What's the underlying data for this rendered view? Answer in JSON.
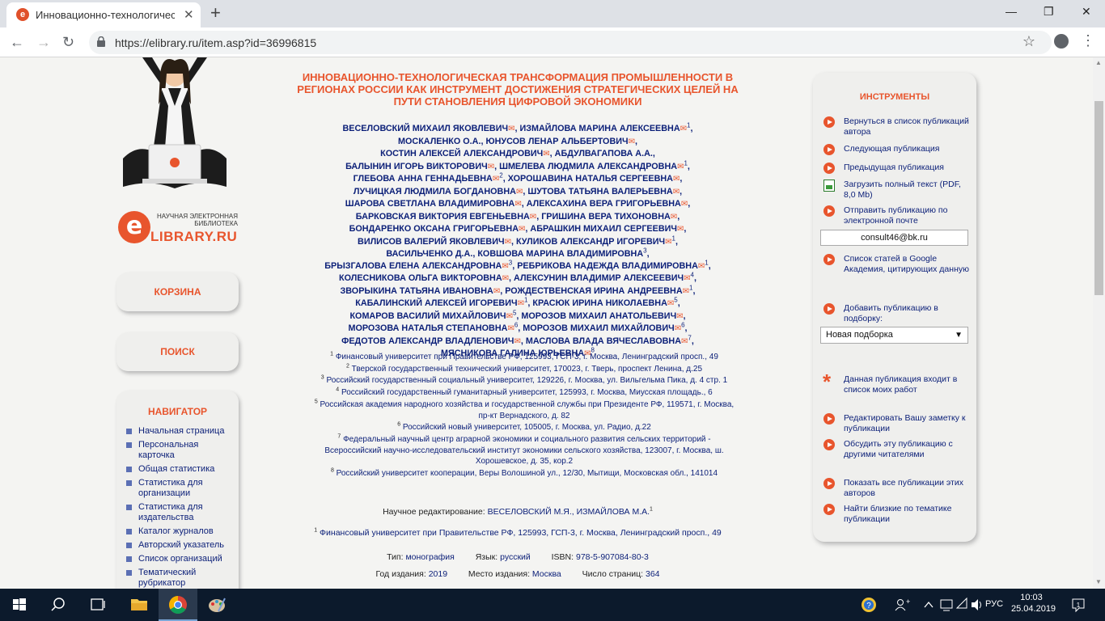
{
  "browser": {
    "tab_title": "Инновационно-технологическа",
    "tab_close": "✕",
    "new_tab": "+",
    "url": "https://elibrary.ru/item.asp?id=36996815",
    "minimize": "—",
    "maximize": "❐",
    "close": "✕"
  },
  "logo": {
    "line1": "НАУЧНАЯ ЭЛЕКТРОННАЯ",
    "line2": "БИБЛИОТЕКА",
    "letter": "e",
    "name": "LIBRARY.RU"
  },
  "sidebar": {
    "cart": "КОРЗИНА",
    "search": "ПОИСК",
    "navigator_title": "НАВИГАТОР",
    "nav_items": [
      "Начальная страница",
      "Персональная карточка",
      "Общая статистика",
      "Статистика для организации",
      "Статистика для издательства",
      "Каталог журналов",
      "Авторский указатель",
      "Список организаций",
      "Тематический рубрикатор"
    ]
  },
  "publication": {
    "title": "ИННОВАЦИОННО-ТЕХНОЛОГИЧЕСКАЯ ТРАНСФОРМАЦИЯ ПРОМЫШЛЕННОСТИ В РЕГИОНАХ РОССИИ КАК ИНСТРУМЕНТ ДОСТИЖЕНИЯ СТРАТЕГИЧЕСКИХ ЦЕЛЕЙ НА ПУТИ СТАНОВЛЕНИЯ ЦИФРОВОЙ ЭКОНОМИКИ",
    "authors": [
      {
        "name": "ВЕСЕЛОВСКИЙ МИХАИЛ ЯКОВЛЕВИЧ",
        "email": true,
        "aff": ""
      },
      {
        "name": "ИЗМАЙЛОВА МАРИНА АЛЕКСЕЕВНА",
        "email": true,
        "aff": "1"
      },
      {
        "name": "МОСКАЛЕНКО О.А.",
        "email": false,
        "aff": ""
      },
      {
        "name": "ЮНУСОВ ЛЕНАР АЛЬБЕРТОВИЧ",
        "email": true,
        "aff": ""
      },
      {
        "name": "КОСТИН АЛЕКСЕЙ АЛЕКСАНДРОВИЧ",
        "email": true,
        "aff": ""
      },
      {
        "name": "АБДУЛВАГАПОВА А.А.",
        "email": false,
        "aff": ""
      },
      {
        "name": "БАЛЫНИН ИГОРЬ ВИКТОРОВИЧ",
        "email": true,
        "aff": ""
      },
      {
        "name": "ШМЕЛЕВА ЛЮДМИЛА АЛЕКСАНДРОВНА",
        "email": true,
        "aff": "1"
      },
      {
        "name": "ГЛЕБОВА АННА ГЕННАДЬЕВНА",
        "email": true,
        "aff": "2"
      },
      {
        "name": "ХОРОШАВИНА НАТАЛЬЯ СЕРГЕЕВНА",
        "email": true,
        "aff": ""
      },
      {
        "name": "ЛУЧИЦКАЯ ЛЮДМИЛА БОГДАНОВНА",
        "email": true,
        "aff": ""
      },
      {
        "name": "ШУТОВА ТАТЬЯНА ВАЛЕРЬЕВНА",
        "email": true,
        "aff": ""
      },
      {
        "name": "ШАРОВА СВЕТЛАНА ВЛАДИМИРОВНА",
        "email": true,
        "aff": ""
      },
      {
        "name": "АЛЕКСАХИНА ВЕРА ГРИГОРЬЕВНА",
        "email": true,
        "aff": ""
      },
      {
        "name": "БАРКОВСКАЯ ВИКТОРИЯ ЕВГЕНЬЕВНА",
        "email": true,
        "aff": ""
      },
      {
        "name": "ГРИШИНА ВЕРА ТИХОНОВНА",
        "email": true,
        "aff": ""
      },
      {
        "name": "БОНДАРЕНКО ОКСАНА ГРИГОРЬЕВНА",
        "email": true,
        "aff": ""
      },
      {
        "name": "АБРАШКИН МИХАИЛ СЕРГЕЕВИЧ",
        "email": true,
        "aff": ""
      },
      {
        "name": "ВИЛИСОВ ВАЛЕРИЙ ЯКОВЛЕВИЧ",
        "email": true,
        "aff": ""
      },
      {
        "name": "КУЛИКОВ АЛЕКСАНДР ИГОРЕВИЧ",
        "email": true,
        "aff": "1"
      },
      {
        "name": "ВАСИЛЬЧЕНКО Д.А.",
        "email": false,
        "aff": ""
      },
      {
        "name": "КОВШОВА МАРИНА ВЛАДИМИРОВНА",
        "email": false,
        "aff": "3"
      },
      {
        "name": "БРЫЗГАЛОВА ЕЛЕНА АЛЕКСАНДРОВНА",
        "email": true,
        "aff": "3"
      },
      {
        "name": "РЕБРИКОВА НАДЕЖДА ВЛАДИМИРОВНА",
        "email": true,
        "aff": "1"
      },
      {
        "name": "КОЛЕСНИКОВА ОЛЬГА ВИКТОРОВНА",
        "email": true,
        "aff": ""
      },
      {
        "name": "АЛЕКСУНИН ВЛАДИМИР АЛЕКСЕЕВИЧ",
        "email": true,
        "aff": "4"
      },
      {
        "name": "ЗВОРЫКИНА ТАТЬЯНА ИВАНОВНА",
        "email": true,
        "aff": ""
      },
      {
        "name": "РОЖДЕСТВЕНСКАЯ ИРИНА АНДРЕЕВНА",
        "email": true,
        "aff": "1"
      },
      {
        "name": "КАБАЛИНСКИЙ АЛЕКСЕЙ ИГОРЕВИЧ",
        "email": true,
        "aff": "1"
      },
      {
        "name": "КРАСЮК ИРИНА НИКОЛАЕВНА",
        "email": true,
        "aff": "5"
      },
      {
        "name": "КОМАРОВ ВАСИЛИЙ МИХАЙЛОВИЧ",
        "email": true,
        "aff": "5"
      },
      {
        "name": "МОРОЗОВ МИХАИЛ АНАТОЛЬЕВИЧ",
        "email": true,
        "aff": ""
      },
      {
        "name": "МОРОЗОВА НАТАЛЬЯ СТЕПАНОВНА",
        "email": true,
        "aff": "6"
      },
      {
        "name": "МОРОЗОВ МИХАИЛ МИХАЙЛОВИЧ",
        "email": true,
        "aff": "6"
      },
      {
        "name": "ФЕДОТОВ АЛЕКСАНДР ВЛАДЛЕНОВИЧ",
        "email": true,
        "aff": ""
      },
      {
        "name": "МАСЛОВА ВЛАДА ВЯЧЕСЛАВОВНА",
        "email": true,
        "aff": "7"
      },
      {
        "name": "МЯСНИКОВА ГАЛИНА ЮРЬЕВНА",
        "email": true,
        "aff": "8"
      }
    ],
    "author_lines": [
      [
        0,
        1
      ],
      [
        2,
        3
      ],
      [
        4,
        5
      ],
      [
        6,
        7
      ],
      [
        8,
        9
      ],
      [
        10,
        11
      ],
      [
        12,
        13
      ],
      [
        14,
        15
      ],
      [
        16,
        17
      ],
      [
        18,
        19
      ],
      [
        20,
        21
      ],
      [
        22,
        23
      ],
      [
        24,
        25
      ],
      [
        26,
        27
      ],
      [
        28,
        29
      ],
      [
        30,
        31
      ],
      [
        32,
        33
      ],
      [
        34,
        35
      ],
      [
        36
      ]
    ],
    "affiliations": [
      {
        "num": "1",
        "text": "Финансовый университет при Правительстве РФ, 125993, ГСП-3, г. Москва, Ленинградский просп., 49"
      },
      {
        "num": "2",
        "text": "Тверской государственный технический университет, 170023, г. Тверь, проспект Ленина, д.25"
      },
      {
        "num": "3",
        "text": "Российский государственный социальный университет, 129226, г. Москва, ул. Вильгельма Пика, д. 4 стр. 1"
      },
      {
        "num": "4",
        "text": "Российский государственный гуманитарный университет, 125993, г. Москва, Миусская площадь., 6"
      },
      {
        "num": "5",
        "text": "Российская академия народного хозяйства и государственной службы при Президенте РФ, 119571, г. Москва, пр-кт Вернадского, д. 82"
      },
      {
        "num": "6",
        "text": "Российский новый университет, 105005, г. Москва, ул. Радио, д.22"
      },
      {
        "num": "7",
        "text": "Федеральный научный центр аграрной экономики и социального развития сельских территорий - Всероссийский научно-исследовательский институт экономики сельского хозяйства, 123007, г. Москва, ш. Хорошевское, д. 35, кор.2"
      },
      {
        "num": "8",
        "text": "Российский университет кооперации, Веры Волошиной ул., 12/30, Мытищи, Московская обл., 141014"
      }
    ],
    "editors_label": "Научное редактирование:",
    "editors": "ВЕСЕЛОВСКИЙ М.Я., ИЗМАЙЛОВА М.А.",
    "editors_aff_num": "1",
    "editors_aff": "Финансовый университет при Правительстве РФ, 125993, ГСП-3, г. Москва, Ленинградский просп., 49",
    "type_label": "Тип:",
    "type": "монография",
    "lang_label": "Язык:",
    "lang": "русский",
    "isbn_label": "ISBN:",
    "isbn": "978-5-907084-80-3",
    "year_label": "Год издания:",
    "year": "2019",
    "place_label": "Место издания:",
    "place": "Москва",
    "pages_label": "Число страниц:",
    "pages": "364"
  },
  "tools": {
    "title": "ИНСТРУМЕНТЫ",
    "back": "Вернуться в список публикаций автора",
    "next": "Следующая публикация",
    "prev": "Предыдущая публикация",
    "download": "Загрузить полный текст (PDF, 8,0 Mb)",
    "send_email": "Отправить публикацию по электронной почте",
    "email_value": "consult46@bk.ru",
    "google_scholar": "Список статей в Google Академия, цитирующих данную",
    "add_collection": "Добавить публикацию в подборку:",
    "collection_value": "Новая подборка",
    "in_my_works": "Данная публикация входит в список моих работ",
    "edit_note": "Редактировать Вашу заметку к публикации",
    "discuss": "Обсудить эту публикацию с другими читателями",
    "show_all": "Показать все публикации этих авторов",
    "find_similar": "Найти близкие по тематике публикации"
  },
  "taskbar": {
    "lang": "РУС",
    "time": "10:03",
    "date": "25.04.2019"
  },
  "colors": {
    "accent": "#e8552d",
    "link": "#0b1f78",
    "page_bg": "#f4f4f2"
  }
}
